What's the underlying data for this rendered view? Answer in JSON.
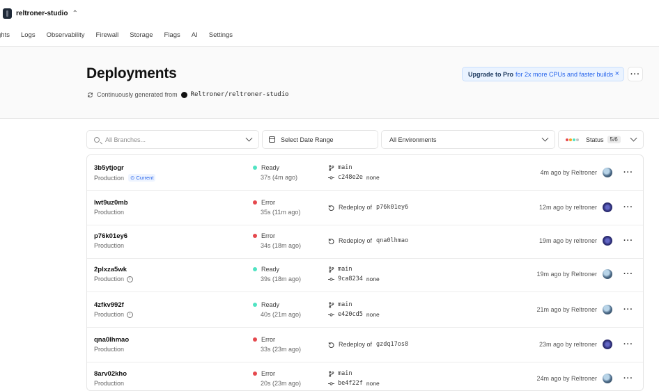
{
  "team": {
    "name": "reltroner-studio",
    "switcher_icon": "chevron-up-down-icon"
  },
  "nav": {
    "tabs": [
      "ghts",
      "Logs",
      "Observability",
      "Firewall",
      "Storage",
      "Flags",
      "AI",
      "Settings"
    ]
  },
  "page": {
    "title": "Deployments",
    "subtitle_prefix": "Continuously generated from",
    "repo": "Reltroner/reltroner-studio"
  },
  "upgrade": {
    "label_bold": "Upgrade to Pro",
    "label_rest": "for 2x more CPUs and faster builds",
    "close": "×"
  },
  "filters": {
    "branches_placeholder": "All Branches...",
    "date_range": "Select Date Range",
    "environments": "All Environments",
    "status_label": "Status",
    "status_count": "5/6",
    "status_dot_colors": [
      "#e5484d",
      "#f5a524",
      "#50e3c2",
      "#8f8f8f"
    ]
  },
  "colors": {
    "ready": "#50e3c2",
    "error": "#e5484d",
    "accent": "#2563eb"
  },
  "deployments": [
    {
      "id": "3b5ytjogr",
      "env": "Production",
      "current": "Current",
      "status": "Ready",
      "duration": "37s (4m ago)",
      "branch": "main",
      "commit": "c248e2e",
      "message": "none",
      "time": "4m ago by Reltroner"
    },
    {
      "id": "lwt9uz0mb",
      "env": "Production",
      "status": "Error",
      "duration": "35s (11m ago)",
      "redeploy": "Redeploy of",
      "redeploy_id": "p76k01ey6",
      "time": "12m ago by reltroner"
    },
    {
      "id": "p76k01ey6",
      "env": "Production",
      "status": "Error",
      "duration": "34s (18m ago)",
      "redeploy": "Redeploy of",
      "redeploy_id": "qna0lhmao",
      "time": "19m ago by reltroner"
    },
    {
      "id": "2plxza5wk",
      "env": "Production",
      "status": "Ready",
      "duration": "39s (18m ago)",
      "branch": "main",
      "commit": "9ca8234",
      "message": "none",
      "time": "19m ago by Reltroner"
    },
    {
      "id": "4zfkv992f",
      "env": "Production",
      "status": "Ready",
      "duration": "40s (21m ago)",
      "branch": "main",
      "commit": "e420cd5",
      "message": "none",
      "time": "21m ago by Reltroner"
    },
    {
      "id": "qna0lhmao",
      "env": "Production",
      "status": "Error",
      "duration": "33s (23m ago)",
      "redeploy": "Redeploy of",
      "redeploy_id": "gzdq17os8",
      "time": "23m ago by reltroner"
    },
    {
      "id": "8arv02kho",
      "env": "Production",
      "status": "Error",
      "duration": "20s (23m ago)",
      "branch": "main",
      "commit": "be4f22f",
      "message": "none",
      "time": "24m ago by Reltroner"
    }
  ]
}
